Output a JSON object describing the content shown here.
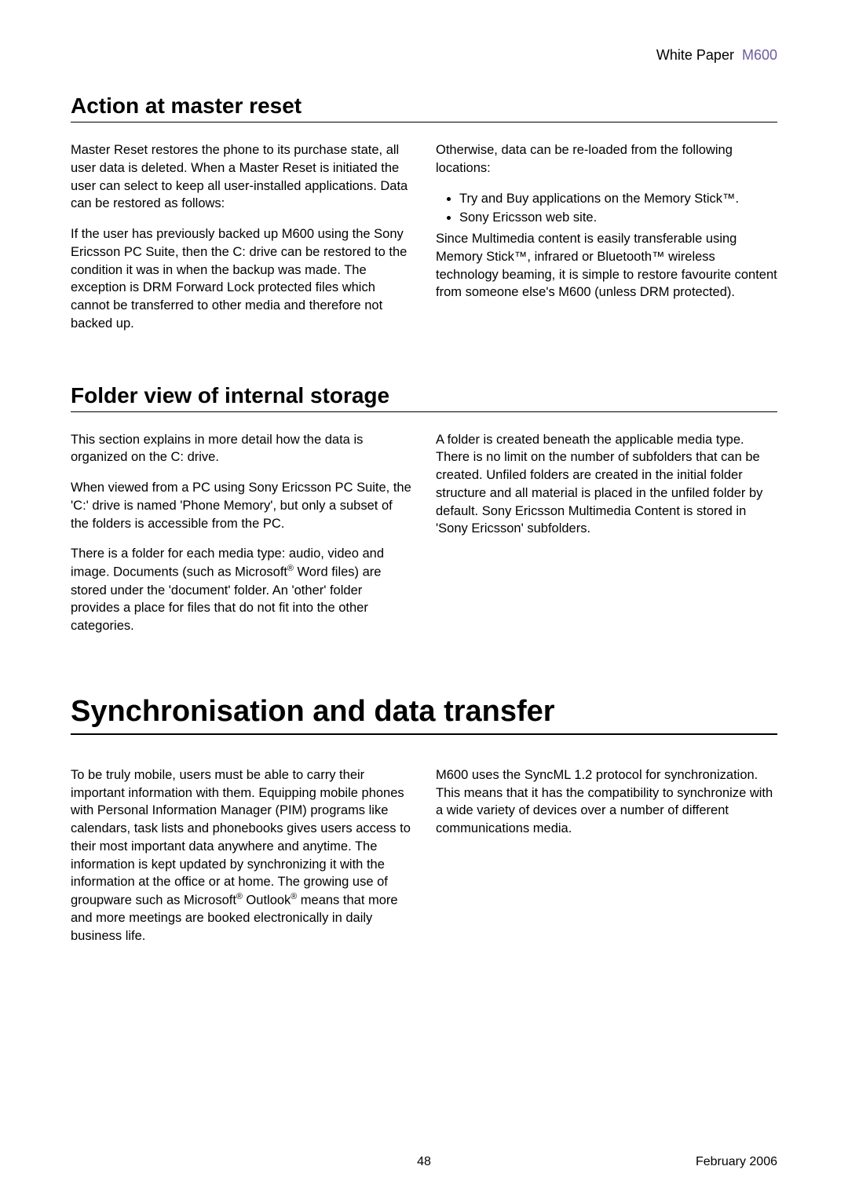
{
  "header": {
    "label": "White Paper",
    "model": "M600"
  },
  "section1": {
    "title": "Action at master reset",
    "left": {
      "p1": "Master Reset restores the phone to its purchase state, all user data is deleted. When a Master Reset is initiated the user can select to keep all user-installed applications. Data can be restored as follows:",
      "p2": "If the user has previously backed up M600 using the Sony Ericsson PC Suite, then the C: drive can be restored to the condition it was in when the backup was made. The exception is DRM Forward Lock protected files which cannot be transferred to other media and therefore not backed up."
    },
    "right": {
      "p1": "Otherwise, data can be re-loaded from the following locations:",
      "bullets": [
        "Try and Buy applications on the Memory Stick™.",
        "Sony Ericsson web site."
      ],
      "p2": "Since Multimedia content is easily transferable using Memory Stick™, infrared or Bluetooth™ wireless technology beaming, it is simple to restore favourite content from someone else's M600 (unless DRM protected)."
    }
  },
  "section2": {
    "title": "Folder view of internal storage",
    "left": {
      "p1": "This section explains in more detail how the data is organized on the C: drive.",
      "p2": "When viewed from a PC using Sony Ericsson PC Suite, the 'C:' drive is named 'Phone Memory', but only a subset of the folders is accessible from the PC.",
      "p3_a": "There is a folder for each media type: audio, video and image. Documents (such as Microsoft",
      "p3_b": " Word files) are stored under the 'document' folder. An 'other' folder provides a place for files that do not fit into the other categories."
    },
    "right": {
      "p1": "A folder is created beneath the applicable media type. There is no limit on the number of subfolders that can be created. Unfiled folders are created in the initial folder structure and all material is placed in the unfiled folder by default. Sony Ericsson Multimedia Content is stored in 'Sony Ericsson' subfolders."
    }
  },
  "chapter": {
    "title": "Synchronisation and data transfer",
    "left": {
      "p1_a": "To be truly mobile, users must be able to carry their important information with them. Equipping mobile phones with Personal Information Manager (PIM) programs like calendars, task lists and phonebooks gives users access to their most important data anywhere and anytime. The information is kept updated by synchronizing it with the information at the office or at home. The growing use of groupware such as Microsoft",
      "p1_b": " Outlook",
      "p1_c": " means that more and more meetings are booked electronically in daily business life."
    },
    "right": {
      "p1": "M600 uses the SyncML 1.2 protocol for synchronization. This means that it has the compatibility to synchronize with a wide variety of devices over a number of different communications media."
    }
  },
  "footer": {
    "page": "48",
    "date": "February 2006"
  }
}
